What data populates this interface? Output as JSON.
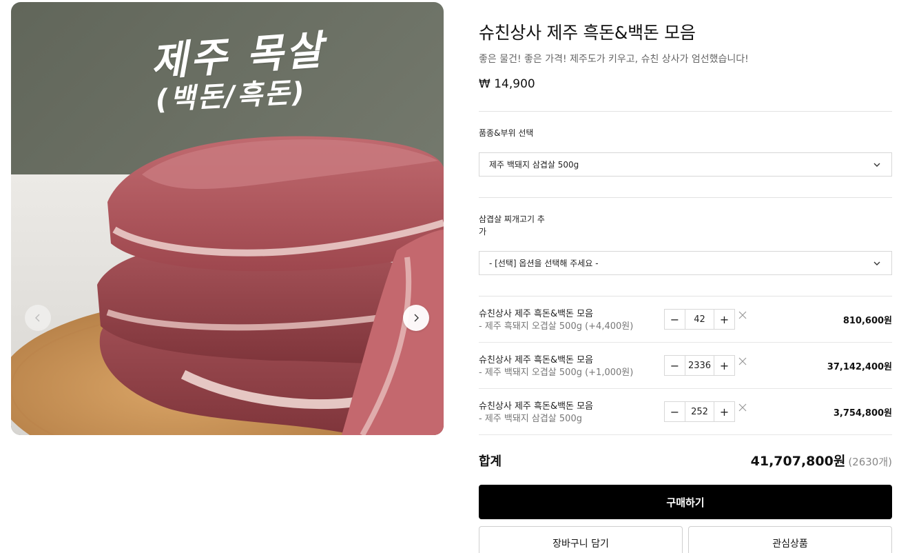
{
  "gallery": {
    "overlay_title": "제주 목살",
    "overlay_subtitle": "(백돈/흑돈)",
    "prev_icon": "chevron-left-icon",
    "next_icon": "chevron-right-icon"
  },
  "product": {
    "title": "슈친상사 제주 흑돈&백돈 모음",
    "subtitle": "좋은 물건! 좋은 가격! 제주도가 키우고, 슈친 상사가 엄선했습니다!",
    "price": "₩ 14,900"
  },
  "options": [
    {
      "label": "품종&부위 선택",
      "selected": "제주 백돼지 삼겹살 500g"
    },
    {
      "label_line1": "삼겹살 찌개고기 추",
      "label_line2": "가",
      "selected": "- [선택] 옵션을 선택해 주세요 -"
    }
  ],
  "selected_items": [
    {
      "name": "슈친상사 제주 흑돈&백돈 모음",
      "option": "- 제주 흑돼지 오겹살 500g (+4,400원)",
      "quantity": "42",
      "price": "810,600원"
    },
    {
      "name": "슈친상사 제주 흑돈&백돈 모음",
      "option": "- 제주 백돼지 오겹살 500g (+1,000원)",
      "quantity": "2336",
      "price": "37,142,400원"
    },
    {
      "name": "슈친상사 제주 흑돈&백돈 모음",
      "option": "- 제주 백돼지 삼겹살 500g",
      "quantity": "252",
      "price": "3,754,800원"
    }
  ],
  "qty_controls": {
    "minus": "−",
    "plus": "+"
  },
  "total": {
    "label": "합계",
    "amount": "41,707,800원",
    "count": "(2630개)"
  },
  "actions": {
    "buy": "구매하기",
    "cart": "장바구니 담기",
    "wishlist": "관심상품"
  },
  "colors": {
    "buy_button": "#000000",
    "wall": "#6b7063",
    "meat": "#b65a5f",
    "board": "#c68f52"
  }
}
